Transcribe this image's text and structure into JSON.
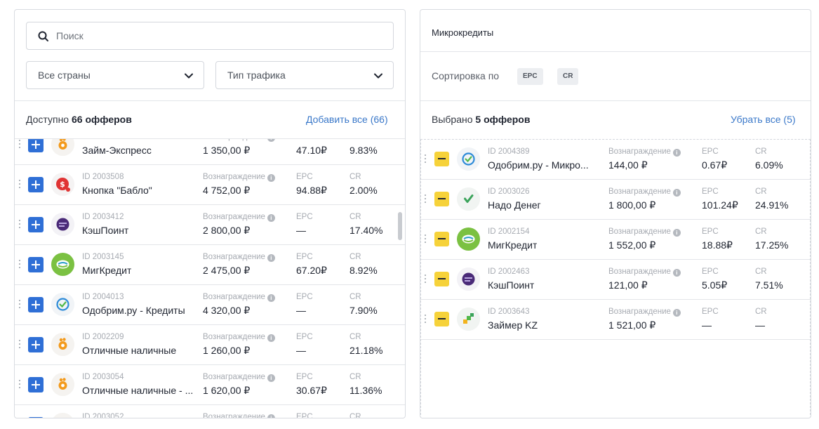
{
  "search": {
    "placeholder": "Поиск",
    "value": ""
  },
  "filters": {
    "countries": "Все страны",
    "traffic": "Тип трафика"
  },
  "available": {
    "prefix": "Доступно",
    "count_text": "66 офферов",
    "add_all": "Добавить все (66)"
  },
  "labels": {
    "reward": "Вознаграждение",
    "epc": "EPC",
    "cr": "CR"
  },
  "available_offers": [
    {
      "id": "",
      "name": "Займ-Экспресс",
      "reward": "1 350,00 ₽",
      "epc": "47.10₽",
      "cr": "9.83%",
      "logo": "orange-hand-icon"
    },
    {
      "id": "ID 2003508",
      "name": "Кнопка \"Бабло\"",
      "reward": "4 752,00 ₽",
      "epc": "94.88₽",
      "cr": "2.00%",
      "logo": "red-dollar-icon"
    },
    {
      "id": "ID 2003412",
      "name": "КэшПоинт",
      "reward": "2 800,00 ₽",
      "epc": "—",
      "cr": "17.40%",
      "logo": "purple-cashpoint-icon"
    },
    {
      "id": "ID 2003145",
      "name": "МигКредит",
      "reward": "2 475,00 ₽",
      "epc": "67.20₽",
      "cr": "8.92%",
      "logo": "green-migkredit-icon"
    },
    {
      "id": "ID 2004013",
      "name": "Одобрим.ру - Кредиты",
      "reward": "4 320,00 ₽",
      "epc": "—",
      "cr": "7.90%",
      "logo": "blue-check-icon"
    },
    {
      "id": "ID 2002209",
      "name": "Отличные наличные",
      "reward": "1 260,00 ₽",
      "epc": "—",
      "cr": "21.18%",
      "logo": "orange-hand-icon"
    },
    {
      "id": "ID 2003054",
      "name": "Отличные наличные - ...",
      "reward": "1 620,00 ₽",
      "epc": "30.67₽",
      "cr": "11.36%",
      "logo": "orange-hand-icon"
    },
    {
      "id": "ID 2003052",
      "name": "",
      "reward": "",
      "epc": "",
      "cr": "",
      "logo": "orange-hand-icon"
    }
  ],
  "right": {
    "title": "Микрокредиты",
    "sort_label": "Сортировка по",
    "sort_epc": "EPC",
    "sort_cr": "CR",
    "selected_prefix": "Выбрано",
    "selected_count_text": "5 офферов",
    "remove_all": "Убрать все (5)"
  },
  "selected_offers": [
    {
      "id": "ID 2004389",
      "name": "Одобрим.ру - Микро...",
      "reward": "144,00 ₽",
      "epc": "0.67₽",
      "cr": "6.09%",
      "logo": "blue-check-icon"
    },
    {
      "id": "ID 2003026",
      "name": "Надо Денег",
      "reward": "1 800,00 ₽",
      "epc": "101.24₽",
      "cr": "24.91%",
      "logo": "green-tick-icon"
    },
    {
      "id": "ID 2002154",
      "name": "МигКредит",
      "reward": "1 552,00 ₽",
      "epc": "18.88₽",
      "cr": "17.25%",
      "logo": "green-migkredit-icon"
    },
    {
      "id": "ID 2002463",
      "name": "КэшПоинт",
      "reward": "121,00 ₽",
      "epc": "5.05₽",
      "cr": "7.51%",
      "logo": "purple-cashpoint-icon"
    },
    {
      "id": "ID 2003643",
      "name": "Займер KZ",
      "reward": "1 521,00 ₽",
      "epc": "—",
      "cr": "—",
      "logo": "green-zaimer-icon"
    }
  ],
  "colors": {
    "accent": "#2f6fd6",
    "link": "#3a78c9",
    "remove": "#f6d23a"
  }
}
